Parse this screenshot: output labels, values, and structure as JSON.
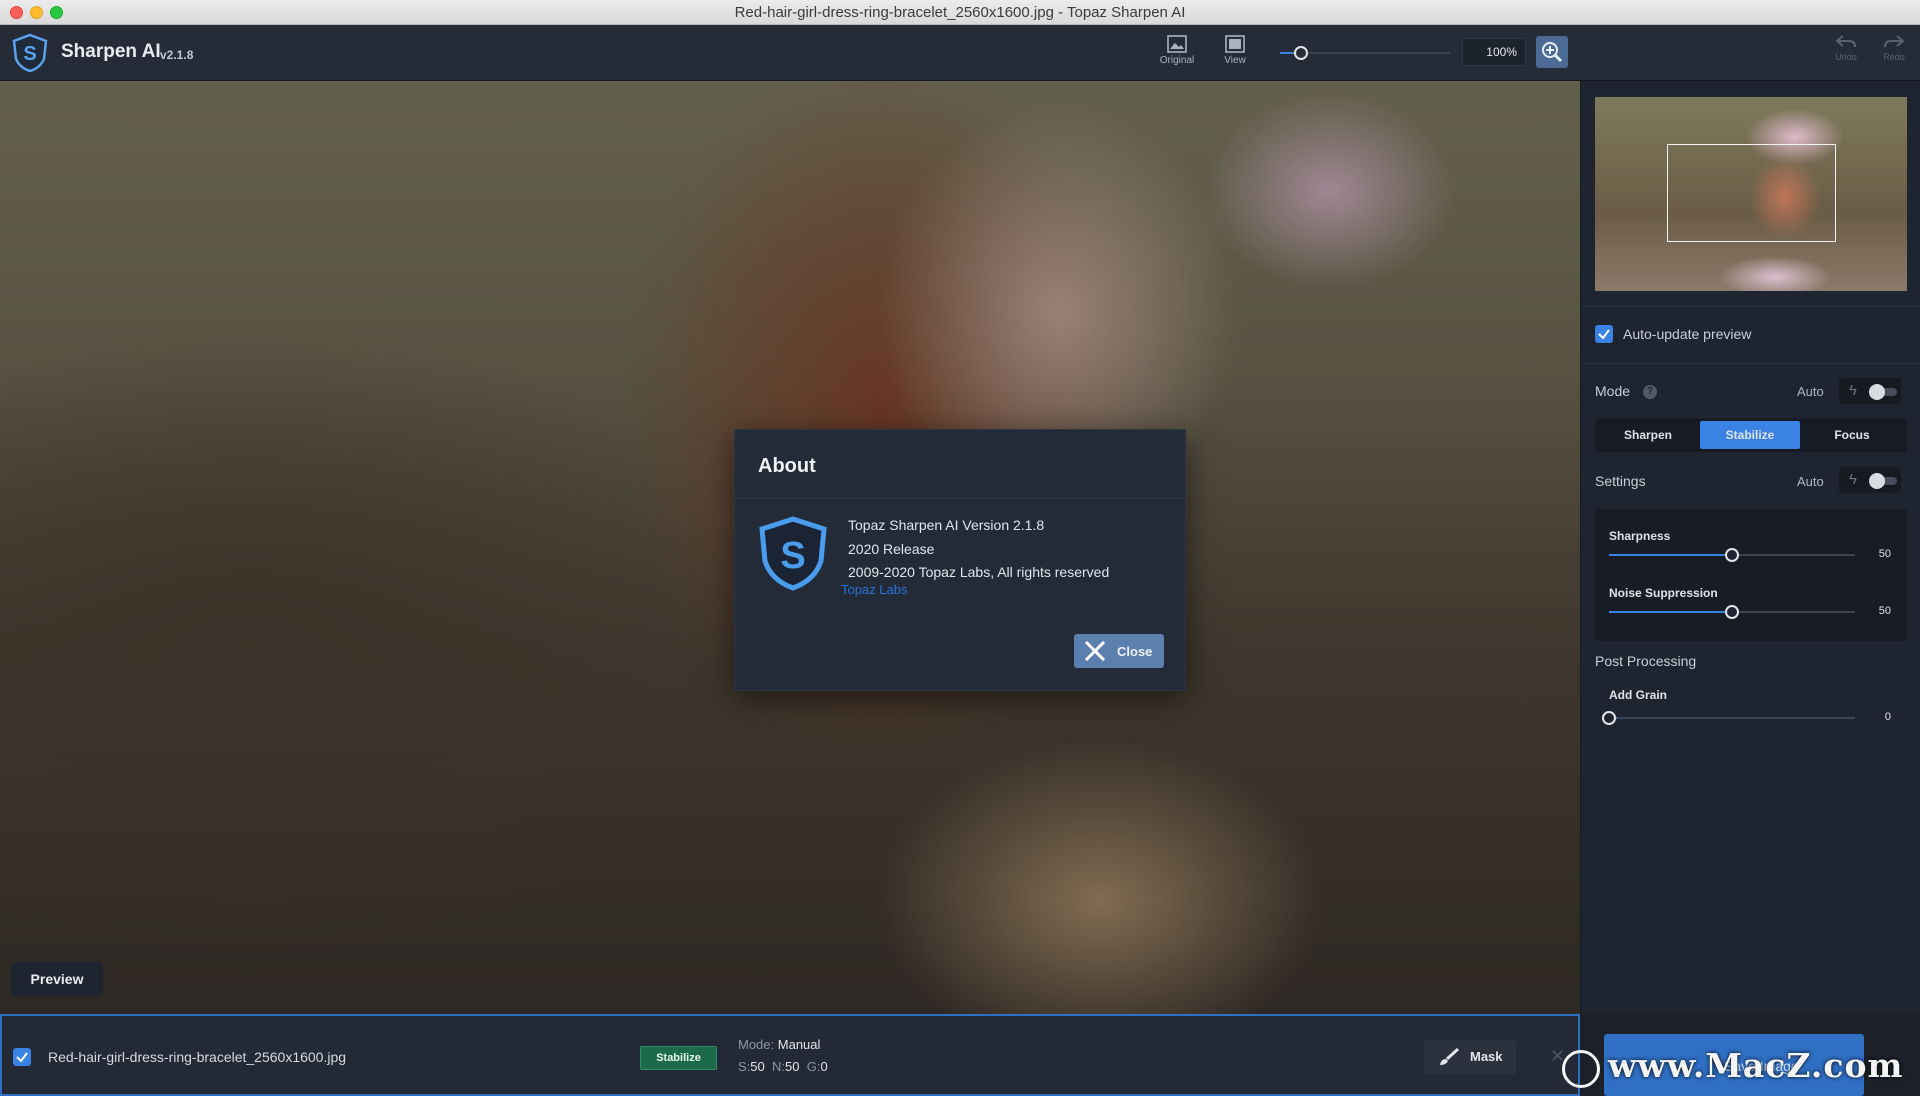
{
  "window": {
    "title": "Red-hair-girl-dress-ring-bracelet_2560x1600.jpg - Topaz Sharpen AI"
  },
  "toolbar": {
    "app_name": "Sharpen AI",
    "app_version": "v2.1.8",
    "original_label": "Original",
    "view_label": "View",
    "zoom_value": "100%",
    "undo_label": "Undo",
    "redo_label": "Redo"
  },
  "canvas": {
    "preview_label": "Preview"
  },
  "panel": {
    "auto_update_label": "Auto-update preview",
    "mode_label": "Mode",
    "mode_auto_label": "Auto",
    "mode_tabs": [
      "Sharpen",
      "Stabilize",
      "Focus"
    ],
    "mode_selected": "Stabilize",
    "settings_label": "Settings",
    "settings_auto_label": "Auto",
    "sliders": [
      {
        "label": "Sharpness",
        "value": "50",
        "fraction": 0.5
      },
      {
        "label": "Noise Suppression",
        "value": "50",
        "fraction": 0.5
      }
    ],
    "post_processing_label": "Post Processing",
    "grain": {
      "label": "Add Grain",
      "value": "0",
      "fraction": 0.0
    }
  },
  "filebar": {
    "file_name": "Red-hair-girl-dress-ring-bracelet_2560x1600.jpg",
    "mode_tag": "Stabilize",
    "mode_key": "Mode:",
    "mode_value": "Manual",
    "s_key": "S:",
    "s_value": "50",
    "n_key": "N:",
    "n_value": "50",
    "g_key": "G:",
    "g_value": "0",
    "mask_label": "Mask",
    "save_label": "Save Image"
  },
  "dialog": {
    "title": "About",
    "line1": "Topaz Sharpen AI Version 2.1.8",
    "line2": "2020 Release",
    "line3": "2009-2020 Topaz Labs, All rights reserved",
    "link": "Topaz Labs",
    "close_label": "Close"
  },
  "watermark": {
    "text": "www.MacZ.com"
  },
  "colors": {
    "accent": "#3a82e4",
    "panel": "#1f2530",
    "toolbar": "#252c38",
    "tag_green": "#1c6a4a"
  }
}
